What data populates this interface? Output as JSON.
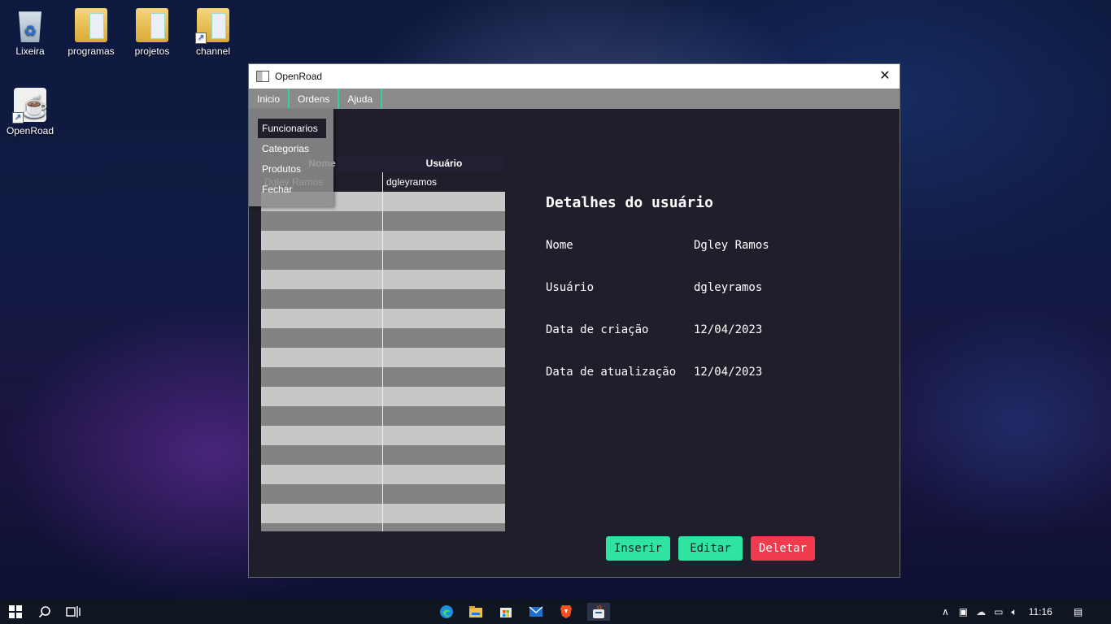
{
  "desktop": {
    "icons": [
      {
        "label": "Lixeira"
      },
      {
        "label": "programas"
      },
      {
        "label": "projetos"
      },
      {
        "label": "channel"
      },
      {
        "label": "OpenRoad"
      }
    ]
  },
  "window": {
    "title": "OpenRoad",
    "close_glyph": "✕",
    "menu": [
      "Inicio",
      "Ordens",
      "Ajuda"
    ],
    "dropdown": [
      "Funcionarios",
      "Categorias",
      "Produtos",
      "Fechar"
    ],
    "table": {
      "columns": [
        "Nome",
        "Usuário"
      ],
      "rows": [
        {
          "nome": "Dgley Ramos",
          "usuario": "dgleyramos"
        }
      ]
    },
    "details": {
      "title": "Detalhes do usuário",
      "fields": [
        {
          "label": "Nome",
          "value": "Dgley Ramos"
        },
        {
          "label": "Usuário",
          "value": "dgleyramos"
        },
        {
          "label": "Data de criação",
          "value": "12/04/2023"
        },
        {
          "label": "Data de atualização",
          "value": "12/04/2023"
        }
      ]
    },
    "buttons": {
      "insert": "Inserir",
      "edit": "Editar",
      "delete": "Deletar"
    },
    "colors": {
      "accent_green": "#2fe3a0",
      "danger_red": "#f03a4d",
      "background": "#1f1f2b"
    }
  },
  "taskbar": {
    "time": "11:16",
    "icons": [
      "windows-start-icon",
      "search-icon",
      "task-view-icon",
      "edge-icon",
      "file-explorer-icon",
      "store-icon",
      "mail-icon",
      "brave-icon",
      "java-app-icon"
    ]
  }
}
